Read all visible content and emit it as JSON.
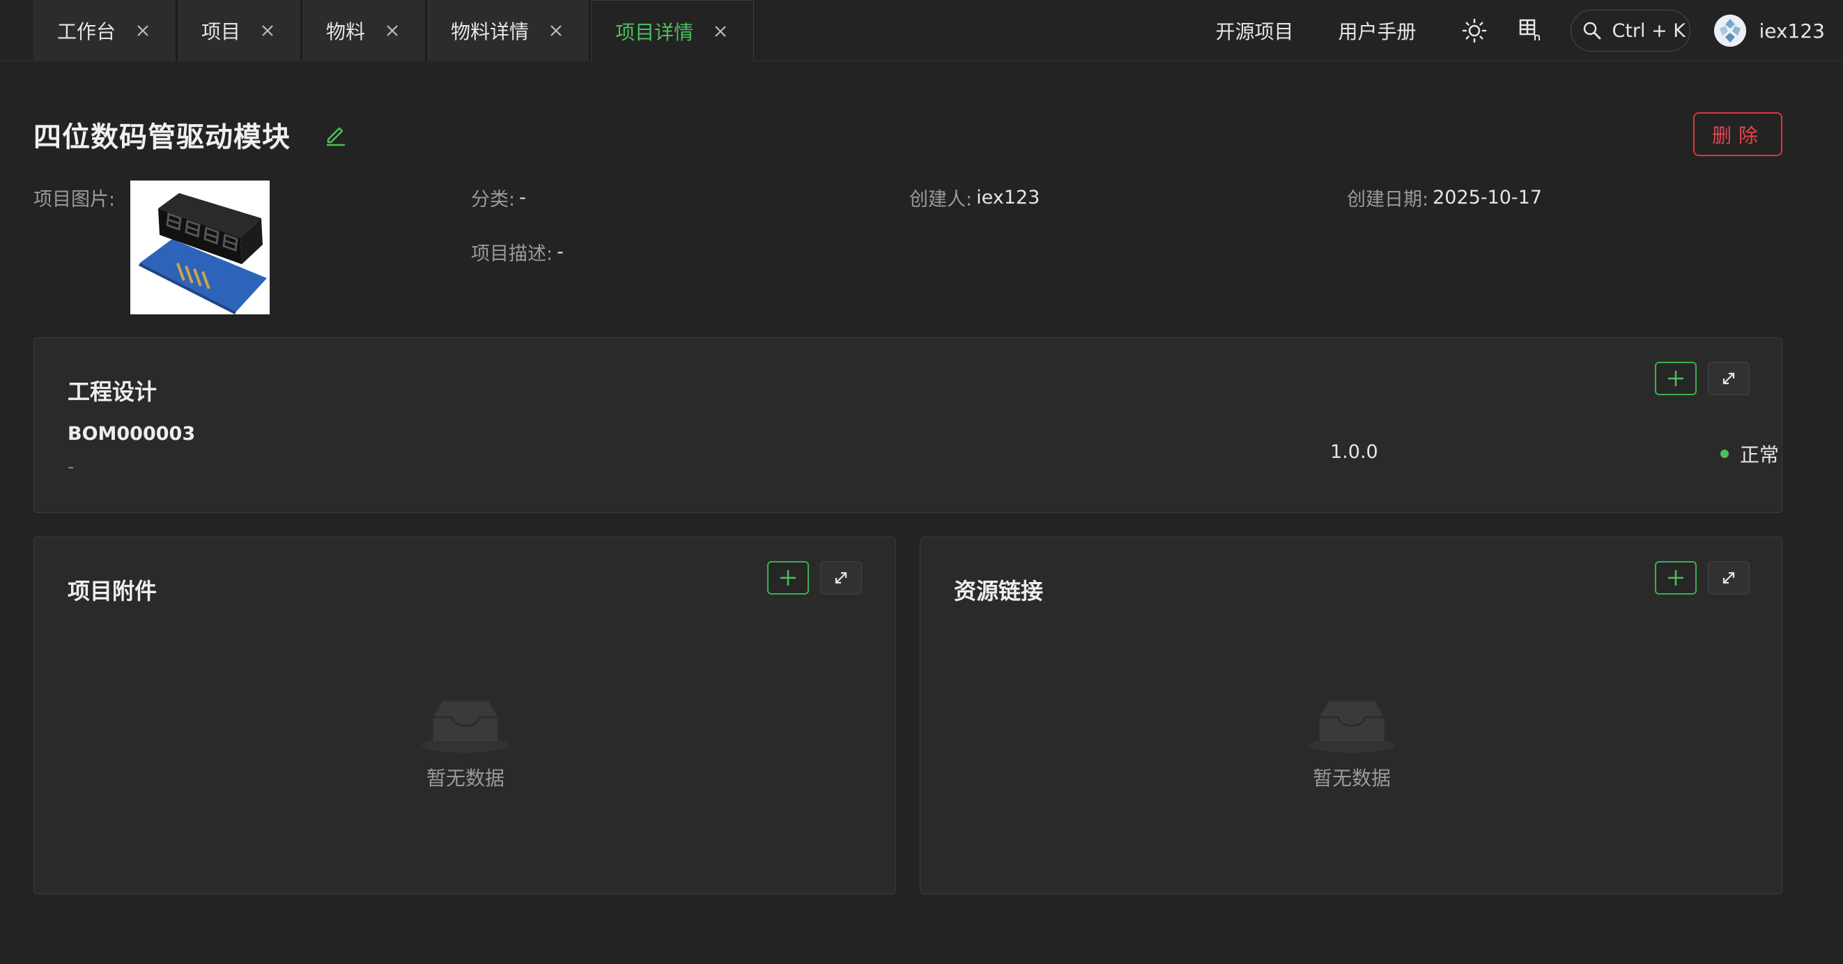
{
  "tabs": [
    {
      "label": "工作台",
      "active": false
    },
    {
      "label": "项目",
      "active": false
    },
    {
      "label": "物料",
      "active": false
    },
    {
      "label": "物料详情",
      "active": false
    },
    {
      "label": "项目详情",
      "active": true
    }
  ],
  "topbar": {
    "open_source": "开源项目",
    "user_manual": "用户手册",
    "search_shortcut": "Ctrl + K",
    "user_name": "iex123"
  },
  "project": {
    "title": "四位数码管驱动模块",
    "delete_label": "删除",
    "image_label": "项目图片:",
    "category_label": "分类:",
    "category_value": "-",
    "creator_label": "创建人:",
    "creator_value": "iex123",
    "created_label": "创建日期:",
    "created_value": "2025-10-17",
    "description_label": "项目描述:",
    "description_value": "-"
  },
  "engineering": {
    "title": "工程设计",
    "bom_code": "BOM000003",
    "bom_desc": "-",
    "version": "1.0.0",
    "status": "正常"
  },
  "attachments": {
    "title": "项目附件",
    "empty_text": "暂无数据"
  },
  "resources": {
    "title": "资源链接",
    "empty_text": "暂无数据"
  },
  "colors": {
    "accent_green": "#4cc05a",
    "danger_red": "#d9363e",
    "background": "#232323",
    "card": "#2a2a2a"
  }
}
